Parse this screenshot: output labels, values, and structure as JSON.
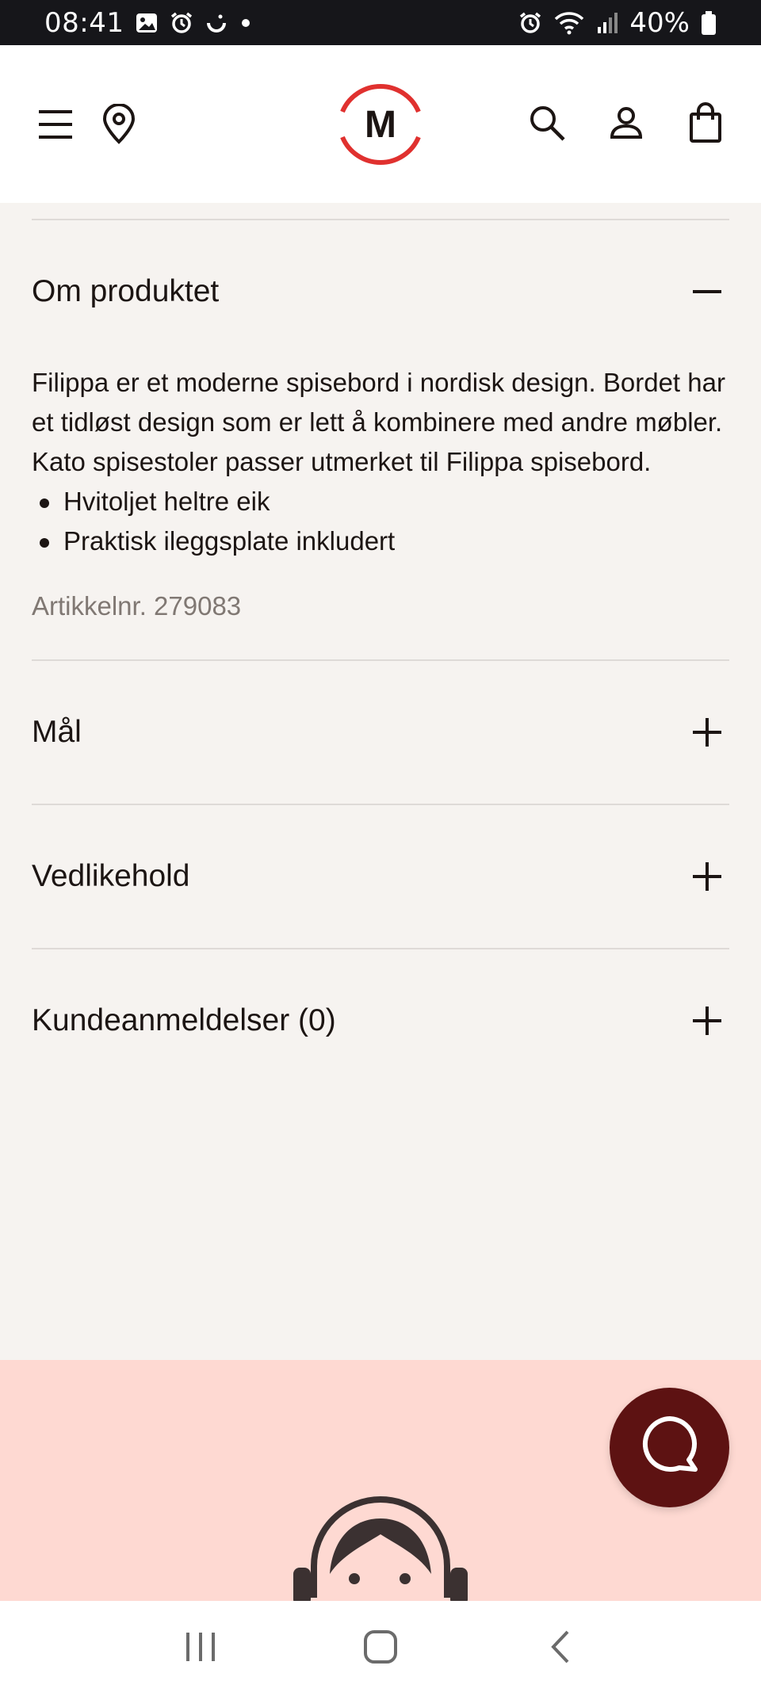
{
  "status_bar": {
    "time": "08:41",
    "battery_percent": "40%",
    "icons_left": [
      "gallery-icon",
      "alarm-icon",
      "smile-icon",
      "dot-icon"
    ],
    "icons_right": [
      "alarm-icon",
      "wifi-icon",
      "signal-icon",
      "battery-icon"
    ]
  },
  "header": {
    "logo_letter": "M",
    "left_icons": [
      "menu-icon",
      "location-pin-icon"
    ],
    "right_icons": [
      "search-icon",
      "account-icon",
      "shopping-bag-icon"
    ],
    "brand_color": "#e0312f"
  },
  "accordion": {
    "about": {
      "title": "Om produktet",
      "expanded": true,
      "description": "Filippa er et moderne spisebord i nordisk design. Bordet har et tidløst design som er lett å kombinere med andre møbler. Kato spisestoler passer utmerket til Filippa spisebord.",
      "bullets": [
        "Hvitoljet heltre eik",
        "Praktisk ileggsplate inkludert"
      ],
      "sku": "Artikkelnr. 279083"
    },
    "sections": [
      {
        "title": "Mål",
        "expanded": false
      },
      {
        "title": "Vedlikehold",
        "expanded": false
      },
      {
        "title": "Kundeanmeldelser (0)",
        "expanded": false
      }
    ]
  },
  "support": {
    "background_color": "#fed9d2",
    "chat_button_color": "#5d1212",
    "icon": "chat-bubble-icon"
  },
  "nav_bar": {
    "buttons": [
      "recents-icon",
      "home-icon",
      "back-icon"
    ]
  }
}
